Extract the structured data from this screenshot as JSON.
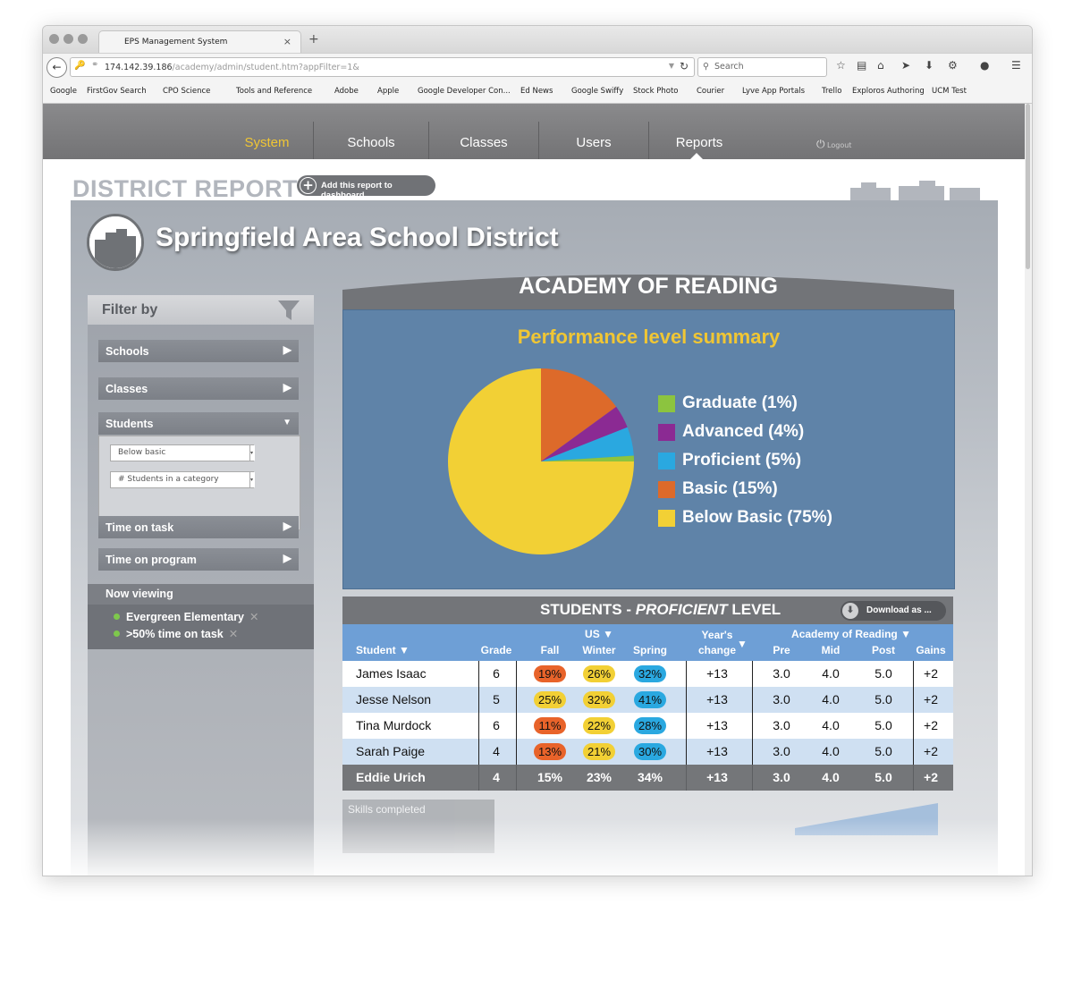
{
  "browser": {
    "tab_title": "EPS Management System",
    "tab_close": "×",
    "new_tab": "+",
    "url_host": "174.142.39.186",
    "url_path": "/academy/admin/student.htm?appFilter=1&",
    "search_placeholder": "Search",
    "bookmarks": [
      "Google",
      "FirstGov Search",
      "CPO Science",
      "Tools and Reference",
      "Adobe",
      "Apple",
      "Google Developer Con...",
      "Ed News",
      "Google Swiffy",
      "Stock Photo",
      "Courier",
      "Lyve App Portals",
      "Trello",
      "Exploros Authoring",
      "UCM Test"
    ]
  },
  "topnav": {
    "items": [
      "System",
      "Schools",
      "Classes",
      "Users",
      "Reports"
    ],
    "active": "System",
    "logout": "Logout"
  },
  "header": {
    "report_title": "DISTRICT REPORT",
    "add_button": "Add this report to dashboard",
    "district_name": "Springfield Area School District"
  },
  "filter": {
    "title": "Filter by",
    "buttons": [
      "Schools",
      "Classes",
      "Students",
      "Time on task",
      "Time on program"
    ],
    "students_selects": [
      "Below basic",
      "# Students in a category"
    ],
    "now_viewing_label": "Now viewing",
    "now_viewing": [
      "Evergreen Elementary",
      ">50% time on task"
    ]
  },
  "academy": {
    "title": "ACADEMY OF READING",
    "chart_title": "Performance level summary"
  },
  "chart_data": {
    "type": "pie",
    "title": "Performance level summary",
    "labels": [
      "Graduate (1%)",
      "Advanced (4%)",
      "Proficient (5%)",
      "Basic (15%)",
      "Below Basic (75%)"
    ],
    "categories": [
      "Graduate",
      "Advanced",
      "Proficient",
      "Basic",
      "Below Basic"
    ],
    "values": [
      1,
      4,
      5,
      15,
      75
    ],
    "colors": [
      "#8cc43f",
      "#8b2a93",
      "#2aa8e0",
      "#dd6a2a",
      "#f2d035"
    ],
    "legend": "right"
  },
  "students_table": {
    "title_prefix": "STUDENTS - ",
    "title_level": "PROFICIENT",
    "title_suffix": " LEVEL",
    "download": "Download as ...",
    "headers": {
      "student": "Student",
      "grade": "Grade",
      "us_group": "US",
      "fall": "Fall",
      "winter": "Winter",
      "spring": "Spring",
      "years_change_1": "Year's",
      "years_change_2": "change",
      "aor_group": "Academy of Reading",
      "pre": "Pre",
      "mid": "Mid",
      "post": "Post",
      "gains": "Gains"
    },
    "rows": [
      {
        "student": "James Isaac",
        "grade": "6",
        "fall": "19%",
        "winter": "26%",
        "spring": "32%",
        "change": "+13",
        "pre": "3.0",
        "mid": "4.0",
        "post": "5.0",
        "gains": "+2"
      },
      {
        "student": "Jesse Nelson",
        "grade": "5",
        "fall": "25%",
        "winter": "32%",
        "spring": "41%",
        "change": "+13",
        "pre": "3.0",
        "mid": "4.0",
        "post": "5.0",
        "gains": "+2"
      },
      {
        "student": "Tina Murdock",
        "grade": "6",
        "fall": "11%",
        "winter": "22%",
        "spring": "28%",
        "change": "+13",
        "pre": "3.0",
        "mid": "4.0",
        "post": "5.0",
        "gains": "+2"
      },
      {
        "student": "Sarah Paige",
        "grade": "4",
        "fall": "13%",
        "winter": "21%",
        "spring": "30%",
        "change": "+13",
        "pre": "3.0",
        "mid": "4.0",
        "post": "5.0",
        "gains": "+2"
      },
      {
        "student": "Eddie Urich",
        "grade": "4",
        "fall": "15%",
        "winter": "23%",
        "spring": "34%",
        "change": "+13",
        "pre": "3.0",
        "mid": "4.0",
        "post": "5.0",
        "gains": "+2"
      }
    ],
    "fall_colors": [
      "#e8632a",
      "#f2d035",
      "#e8632a",
      "#e8632a"
    ],
    "winter_color": "#f2d035",
    "spring_color": "#2aa8e0"
  },
  "footer_hint": {
    "skills_completed": "Skills completed"
  }
}
